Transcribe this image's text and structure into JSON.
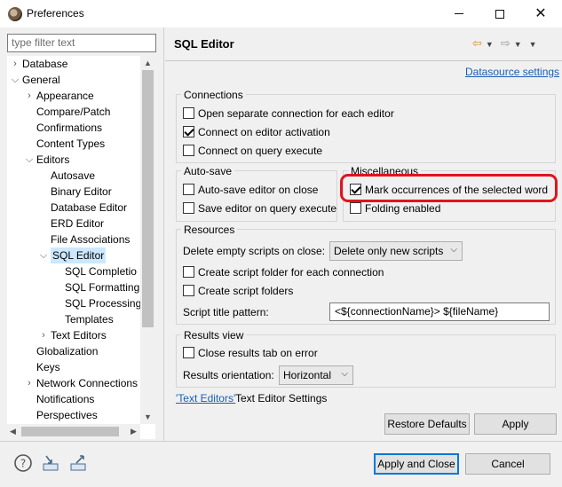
{
  "window": {
    "title": "Preferences",
    "controls": {
      "minimize": "—",
      "maximize": "□",
      "close": "✕"
    }
  },
  "filter": {
    "placeholder": "type filter text"
  },
  "tree": {
    "items": [
      {
        "label": "Database",
        "depth": 0,
        "expander": "collapsed"
      },
      {
        "label": "General",
        "depth": 0,
        "expander": "expanded"
      },
      {
        "label": "Appearance",
        "depth": 1,
        "expander": "collapsed"
      },
      {
        "label": "Compare/Patch",
        "depth": 1,
        "expander": "none"
      },
      {
        "label": "Confirmations",
        "depth": 1,
        "expander": "none"
      },
      {
        "label": "Content Types",
        "depth": 1,
        "expander": "none"
      },
      {
        "label": "Editors",
        "depth": 1,
        "expander": "expanded"
      },
      {
        "label": "Autosave",
        "depth": 2,
        "expander": "none"
      },
      {
        "label": "Binary Editor",
        "depth": 2,
        "expander": "none"
      },
      {
        "label": "Database Editor",
        "depth": 2,
        "expander": "none"
      },
      {
        "label": "ERD Editor",
        "depth": 2,
        "expander": "none"
      },
      {
        "label": "File Associations",
        "depth": 2,
        "expander": "none"
      },
      {
        "label": "SQL Editor",
        "depth": 2,
        "expander": "expanded",
        "selected": true
      },
      {
        "label": "SQL Completio",
        "depth": 3,
        "expander": "none"
      },
      {
        "label": "SQL Formatting",
        "depth": 3,
        "expander": "none"
      },
      {
        "label": "SQL Processing",
        "depth": 3,
        "expander": "none"
      },
      {
        "label": "Templates",
        "depth": 3,
        "expander": "none"
      },
      {
        "label": "Text Editors",
        "depth": 2,
        "expander": "collapsed"
      },
      {
        "label": "Globalization",
        "depth": 1,
        "expander": "none"
      },
      {
        "label": "Keys",
        "depth": 1,
        "expander": "none"
      },
      {
        "label": "Network Connections",
        "depth": 1,
        "expander": "collapsed"
      },
      {
        "label": "Notifications",
        "depth": 1,
        "expander": "none"
      },
      {
        "label": "Perspectives",
        "depth": 1,
        "expander": "none"
      }
    ]
  },
  "page": {
    "title": "SQL Editor",
    "datasource_link": "Datasource settings",
    "connections": {
      "label": "Connections",
      "open_separate": "Open separate connection for each editor",
      "connect_activation": "Connect on editor activation",
      "connect_query": "Connect on query execute",
      "open_separate_checked": false,
      "connect_activation_checked": true,
      "connect_query_checked": false
    },
    "autosave": {
      "label": "Auto-save",
      "on_close": "Auto-save editor on close",
      "on_query": "Save editor on query execute"
    },
    "misc": {
      "label": "Miscellaneous",
      "mark_occurrences": "Mark occurrences of the selected word",
      "folding": "Folding enabled",
      "mark_occurrences_checked": true,
      "folding_checked": false
    },
    "resources": {
      "label": "Resources",
      "delete_empty_label": "Delete empty scripts on close:",
      "delete_empty_value": "Delete only new scripts",
      "create_folder_each": "Create script folder for each connection",
      "create_folders": "Create script folders",
      "title_pattern_label": "Script title pattern:",
      "title_pattern_value": "<${connectionName}> ${fileName}"
    },
    "results": {
      "label": "Results view",
      "close_tab": "Close results tab on error",
      "orientation_label": "Results orientation:",
      "orientation_value": "Horizontal"
    },
    "text_editors_link": "'Text Editors'",
    "text_editors_rest": " Text Editor Settings",
    "restore_defaults": "Restore Defaults",
    "apply": "Apply"
  },
  "footer": {
    "apply_close": "Apply and Close",
    "cancel": "Cancel"
  },
  "colors": {
    "accent_link": "#1a5fb4",
    "highlight_annotation": "#e0141e",
    "selection": "#cce8ff"
  }
}
